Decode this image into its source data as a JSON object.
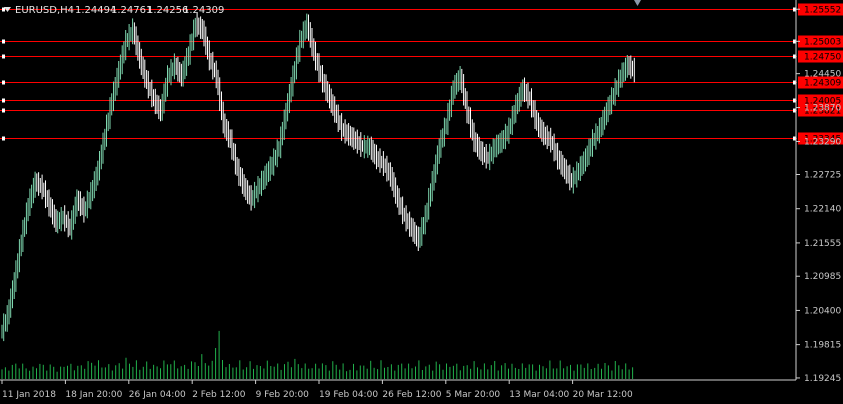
{
  "header": {
    "symbol": "EURUSD,H4",
    "open": "1.24494",
    "high": "1.24761",
    "low": "1.24256",
    "close": "1.24309"
  },
  "colors": {
    "background": "#000000",
    "candle_up": "#7fd8b0",
    "candle_down": "#ffffff",
    "volume": "#22b14c",
    "hline": "#ff0000",
    "axis": "#cfcfcf"
  },
  "chart_data": {
    "type": "line",
    "title": "EURUSD,H4",
    "ylim": [
      1.1921,
      1.2571
    ],
    "y_ticks": [
      "1.25552",
      "1.25003",
      "1.24450",
      "1.23870",
      "1.23290",
      "1.22725",
      "1.22140",
      "1.21555",
      "1.20985",
      "1.20400",
      "1.19815",
      "1.19245"
    ],
    "x_ticks": [
      "11 Jan 2018",
      "18 Jan 20:00",
      "26 Jan 04:00",
      "2 Feb 12:00",
      "9 Feb 20:00",
      "19 Feb 04:00",
      "26 Feb 12:00",
      "5 Mar 20:00",
      "13 Mar 04:00",
      "20 Mar 12:00"
    ],
    "horizontal_lines": [
      "1.25552",
      "1.25003",
      "1.24750",
      "1.24309",
      "1.24005",
      "1.23821",
      "1.23345"
    ],
    "series": [
      {
        "values": [
          1.2,
          1.203,
          1.209,
          1.216,
          1.222,
          1.226,
          1.225,
          1.222,
          1.219,
          1.22,
          1.218,
          1.223,
          1.221,
          1.224,
          1.228,
          1.234,
          1.24,
          1.245,
          1.25,
          1.252,
          1.247,
          1.243,
          1.24,
          1.238,
          1.244,
          1.246,
          1.244,
          1.248,
          1.253,
          1.252,
          1.247,
          1.244,
          1.236,
          1.233,
          1.228,
          1.225,
          1.223,
          1.225,
          1.227,
          1.229,
          1.232,
          1.238,
          1.244,
          1.25,
          1.253,
          1.248,
          1.244,
          1.241,
          1.238,
          1.235,
          1.234,
          1.233,
          1.232,
          1.232,
          1.23,
          1.229,
          1.227,
          1.223,
          1.22,
          1.218,
          1.216,
          1.22,
          1.226,
          1.232,
          1.236,
          1.242,
          1.244,
          1.238,
          1.233,
          1.231,
          1.23,
          1.232,
          1.233,
          1.235,
          1.239,
          1.242,
          1.24,
          1.236,
          1.234,
          1.233,
          1.23,
          1.228,
          1.226,
          1.228,
          1.23,
          1.233,
          1.235,
          1.238,
          1.241,
          1.244,
          1.246,
          1.245
        ]
      }
    ],
    "volume": [
      4,
      5,
      6,
      5,
      4,
      6,
      5,
      5,
      4,
      6,
      5,
      5,
      6,
      7,
      6,
      5,
      5,
      6,
      7,
      6,
      5,
      6,
      5,
      6,
      7,
      6,
      5,
      6,
      7,
      8,
      6,
      18,
      7,
      5,
      6,
      5,
      6,
      5,
      6,
      6,
      5,
      6,
      7,
      6,
      5,
      5,
      6,
      5,
      6,
      5,
      4,
      5,
      5,
      6,
      5,
      6,
      5,
      5,
      6,
      5,
      6,
      5,
      5,
      6,
      5,
      6,
      5,
      5,
      6,
      5,
      5,
      6,
      5,
      6,
      5,
      5,
      6,
      5,
      5,
      6,
      5,
      6,
      5,
      5,
      6,
      5,
      5,
      6,
      5,
      6,
      5,
      5
    ]
  }
}
